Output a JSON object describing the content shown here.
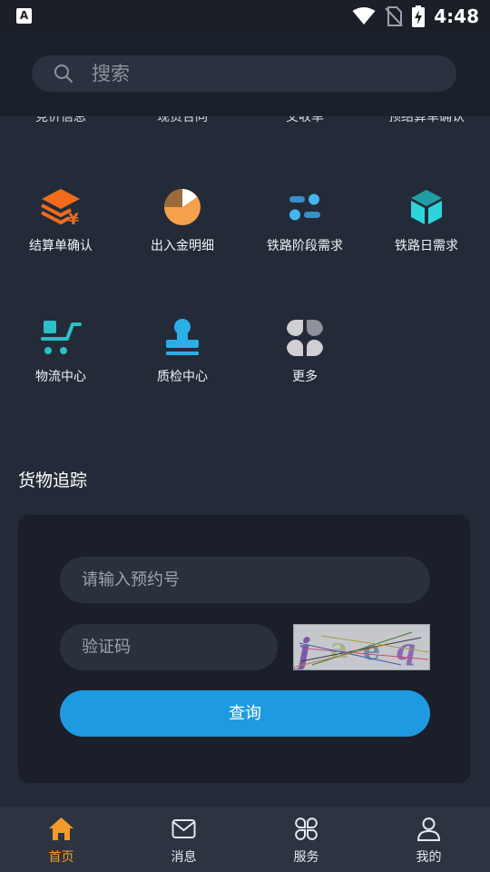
{
  "status_bar": {
    "time": "4:48",
    "app_icon_letter": "A"
  },
  "search": {
    "placeholder": "搜索"
  },
  "cut_off_row": [
    "竞价信息",
    "现货合同",
    "交收单",
    "预结算单确认"
  ],
  "grid": [
    {
      "label": "结算单确认",
      "icon": "stacked-yen-icon",
      "color": "#f26b1d"
    },
    {
      "label": "出入金明细",
      "icon": "pie-chart-icon",
      "color": "#f5a04a"
    },
    {
      "label": "铁路阶段需求",
      "icon": "toggle-settings-icon",
      "color": "#3ba3d9"
    },
    {
      "label": "铁路日需求",
      "icon": "cube-icon",
      "color": "#27c3c9"
    },
    {
      "label": "物流中心",
      "icon": "cart-icon",
      "color": "#2ac0c6"
    },
    {
      "label": "质检中心",
      "icon": "stamp-icon",
      "color": "#2aaee6"
    },
    {
      "label": "更多",
      "icon": "more-grid-icon",
      "color": "#c9c9cf"
    }
  ],
  "tracking": {
    "title": "货物追踪",
    "reservation_placeholder": "请输入预约号",
    "captcha_placeholder": "验证码",
    "query_label": "查询"
  },
  "tabbar": [
    {
      "label": "首页",
      "icon": "home-icon",
      "active": true
    },
    {
      "label": "消息",
      "icon": "mail-icon",
      "active": false
    },
    {
      "label": "服务",
      "icon": "services-icon",
      "active": false
    },
    {
      "label": "我的",
      "icon": "user-icon",
      "active": false
    }
  ],
  "colors": {
    "accent": "#1e9be0",
    "active_tab": "#f39a2b",
    "background": "#232b38"
  }
}
